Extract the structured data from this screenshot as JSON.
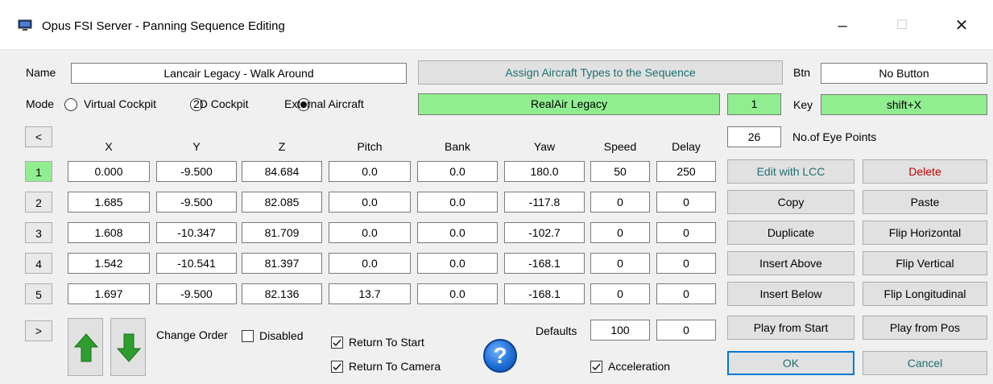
{
  "window": {
    "title": "Opus FSI Server - Panning Sequence Editing",
    "minimize": "–",
    "maximize": "☐",
    "close": "✕"
  },
  "name_label": "Name",
  "name_value": "Lancair Legacy - Walk Around",
  "assign_button": "Assign Aircraft Types to the Sequence",
  "btn_label": "Btn",
  "btn_value": "No Button",
  "mode_label": "Mode",
  "modes": [
    "Virtual Cockpit",
    "2D Cockpit",
    "External Aircraft"
  ],
  "mode_selected": "External Aircraft",
  "aircraft_value": "RealAir Legacy",
  "aircraft_index": "1",
  "key_label": "Key",
  "key_value": "shift+X",
  "eye_points_count": "26",
  "eye_points_label": "No.of Eye Points",
  "prev_button": "<",
  "next_button": ">",
  "columns": [
    "X",
    "Y",
    "Z",
    "Pitch",
    "Bank",
    "Yaw",
    "Speed",
    "Delay"
  ],
  "rows": [
    {
      "num": "1",
      "x": "0.000",
      "y": "-9.500",
      "z": "84.684",
      "pitch": "0.0",
      "bank": "0.0",
      "yaw": "180.0",
      "speed": "50",
      "delay": "250"
    },
    {
      "num": "2",
      "x": "1.685",
      "y": "-9.500",
      "z": "82.085",
      "pitch": "0.0",
      "bank": "0.0",
      "yaw": "-117.8",
      "speed": "0",
      "delay": "0"
    },
    {
      "num": "3",
      "x": "1.608",
      "y": "-10.347",
      "z": "81.709",
      "pitch": "0.0",
      "bank": "0.0",
      "yaw": "-102.7",
      "speed": "0",
      "delay": "0"
    },
    {
      "num": "4",
      "x": "1.542",
      "y": "-10.541",
      "z": "81.397",
      "pitch": "0.0",
      "bank": "0.0",
      "yaw": "-168.1",
      "speed": "0",
      "delay": "0"
    },
    {
      "num": "5",
      "x": "1.697",
      "y": "-9.500",
      "z": "82.136",
      "pitch": "13.7",
      "bank": "0.0",
      "yaw": "-168.1",
      "speed": "0",
      "delay": "0"
    }
  ],
  "actions": {
    "edit_lcc": "Edit with LCC",
    "delete": "Delete",
    "copy": "Copy",
    "paste": "Paste",
    "duplicate": "Duplicate",
    "flip_horizontal": "Flip Horizontal",
    "insert_above": "Insert Above",
    "flip_vertical": "Flip Vertical",
    "insert_below": "Insert Below",
    "flip_longitudinal": "Flip Longitudinal",
    "play_from_start": "Play from Start",
    "play_from_pos": "Play from Pos",
    "ok": "OK",
    "cancel": "Cancel"
  },
  "change_order_label": "Change Order",
  "disabled_label": "Disabled",
  "disabled_checked": false,
  "return_to_start_label": "Return To Start",
  "return_to_start_checked": true,
  "return_to_camera_label": "Return To Camera",
  "return_to_camera_checked": true,
  "defaults_label": "Defaults",
  "defaults_speed": "100",
  "defaults_delay": "0",
  "acceleration_label": "Acceleration",
  "acceleration_checked": true,
  "help_glyph": "?",
  "icons": [
    "app-icon",
    "up-arrow-icon",
    "down-arrow-icon",
    "help-icon"
  ],
  "colors": {
    "highlight_green": "#90ee90",
    "focus_blue": "#0078d7",
    "delete_red": "#c00000",
    "arrow_green": "#2e9e2e"
  }
}
